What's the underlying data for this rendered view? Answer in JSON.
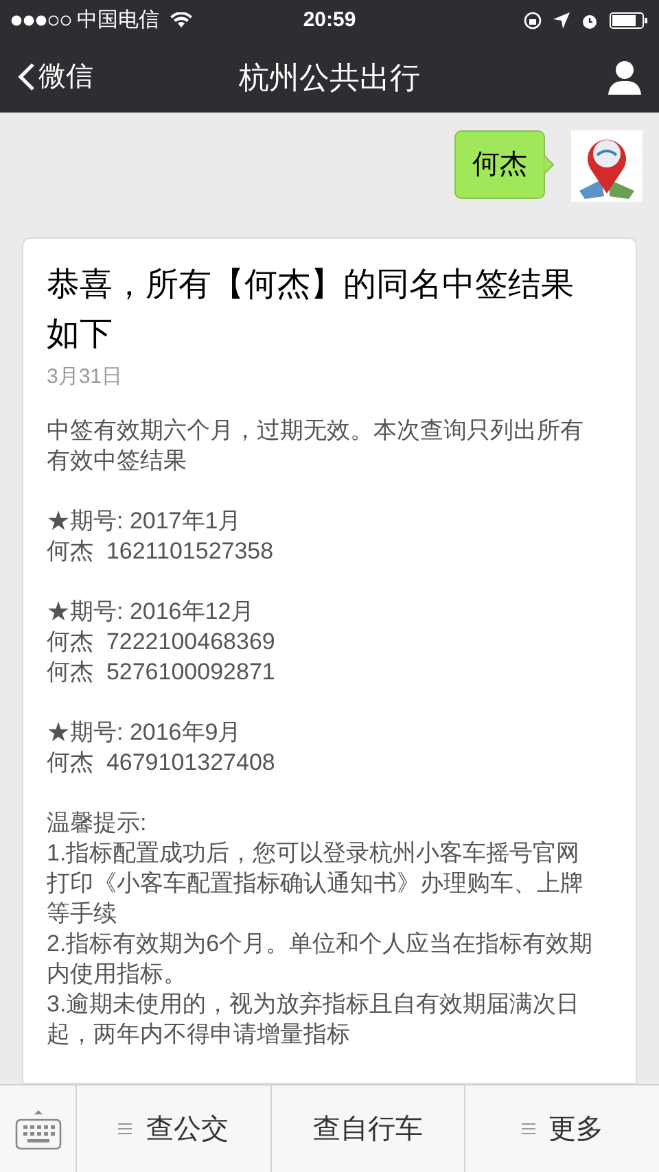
{
  "status_bar": {
    "carrier": "中国电信",
    "time": "20:59"
  },
  "nav": {
    "back_label": "微信",
    "title": "杭州公共出行"
  },
  "sent_message": {
    "text": "何杰"
  },
  "article": {
    "title": "恭喜，所有【何杰】的同名中签结果如下",
    "date": "3月31日",
    "intro": "中签有效期六个月，过期无效。本次查询只列出所有有效中签结果",
    "results": [
      {
        "period": "★期号: 2017年1月",
        "entries": [
          "何杰  1621101527358"
        ]
      },
      {
        "period": "★期号: 2016年12月",
        "entries": [
          "何杰  7222100468369",
          "何杰  5276100092871"
        ]
      },
      {
        "period": "★期号: 2016年9月",
        "entries": [
          "何杰  4679101327408"
        ]
      }
    ],
    "tips_heading": "温馨提示:",
    "tips": [
      "1.指标配置成功后，您可以登录杭州小客车摇号官网打印《小客车配置指标确认通知书》办理购车、上牌等手续",
      "2.指标有效期为6个月。单位和个人应当在指标有效期内使用指标。",
      "3.逾期未使用的，视为放弃指标且自有效期届满次日起，两年内不得申请增量指标"
    ]
  },
  "menu": [
    {
      "label": "查公交",
      "has_submenu": true
    },
    {
      "label": "查自行车",
      "has_submenu": false
    },
    {
      "label": "更多",
      "has_submenu": true
    }
  ]
}
